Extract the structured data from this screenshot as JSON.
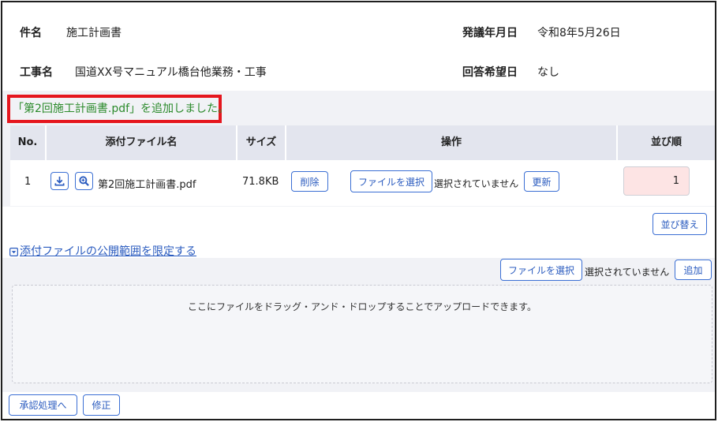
{
  "info": {
    "subject_label": "件名",
    "subject_value": "施工計画書",
    "issue_date_label": "発議年月日",
    "issue_date_value": "令和8年5月26日",
    "work_label": "工事名",
    "work_value": "国道XX号マニュアル橋台他業務・工事",
    "reply_label": "回答希望日",
    "reply_value": "なし"
  },
  "notice": "「第2回施工計画書.pdf」を追加しました。",
  "table": {
    "headers": {
      "no": "No.",
      "filename": "添付ファイル名",
      "size": "サイズ",
      "ops": "操作",
      "order": "並び順"
    },
    "rows": [
      {
        "no": "1",
        "filename": "第2回施工計画書.pdf",
        "size": "71.8KB",
        "delete_label": "削除",
        "choose_label": "ファイルを選択",
        "choose_status": "選択されていません",
        "update_label": "更新",
        "order_value": "1"
      }
    ]
  },
  "sort_button": "並び替え",
  "scope_link": "添付ファイルの公開範囲を限定する",
  "upload": {
    "choose_label": "ファイルを選択",
    "choose_status": "選択されていません",
    "add_label": "追加",
    "dropzone_text": "ここにファイルをドラッグ・アンド・ドロップすることでアップロードできます。"
  },
  "footer": {
    "approve_label": "承認処理へ",
    "edit_label": "修正"
  },
  "colors": {
    "accent": "#3b6fd4",
    "notice_text": "#2b8a2b",
    "notice_border": "#e5161e",
    "order_bg": "#fde4e4"
  },
  "icons": {
    "download": "download-icon",
    "preview": "magnifier-icon",
    "toggle": "collapse-square-icon"
  }
}
